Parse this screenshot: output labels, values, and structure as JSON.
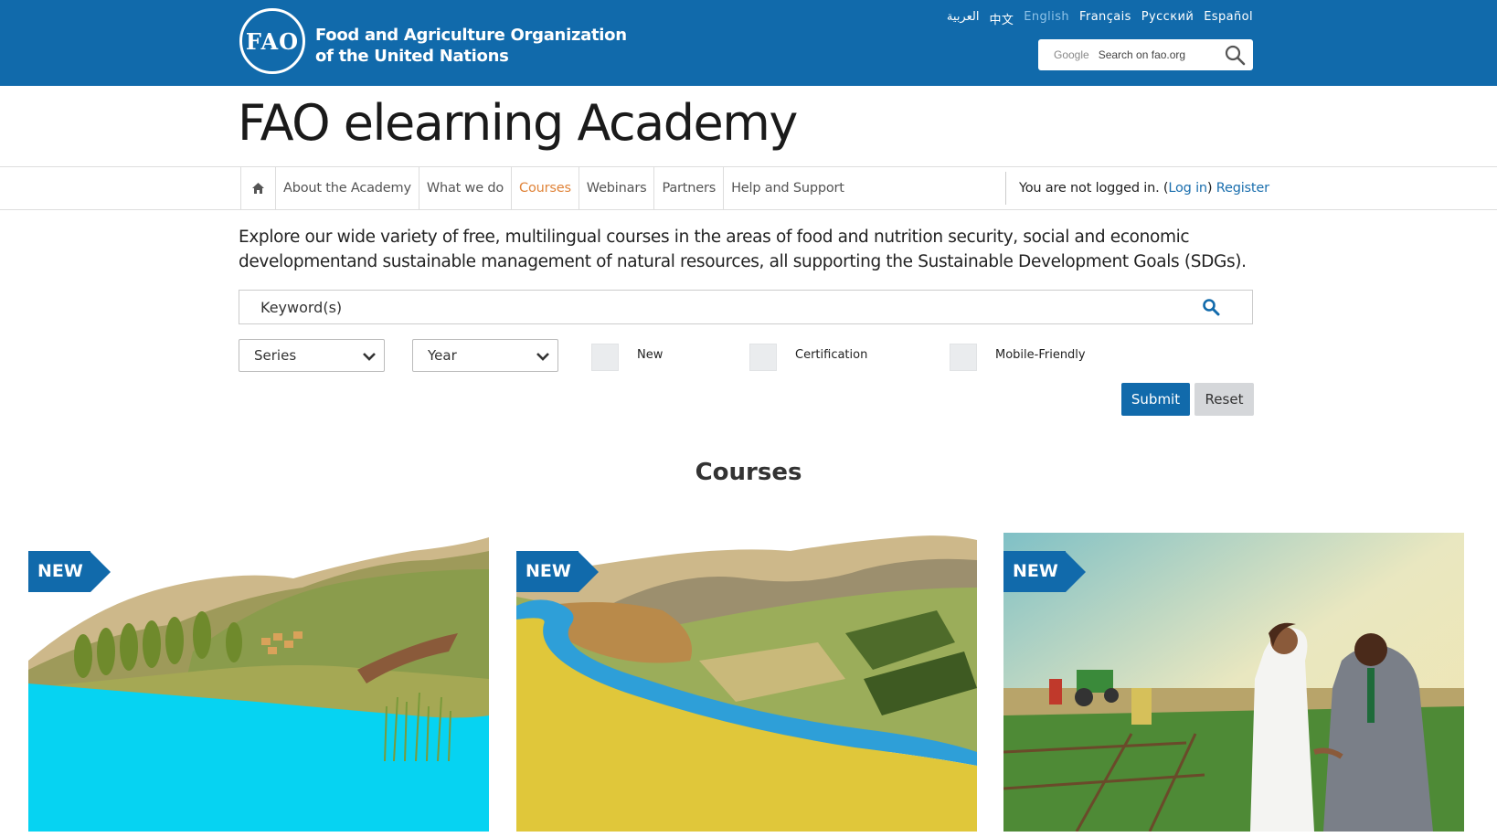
{
  "header": {
    "org_line1": "Food and Agriculture Organization",
    "org_line2": "of the United Nations",
    "logo_text": "FAO",
    "languages": [
      "العربية",
      "中文",
      "English",
      "Français",
      "Русский",
      "Español"
    ],
    "active_language": "English",
    "search_provider": "Google",
    "search_placeholder": "Search on fao.org"
  },
  "site_title": "FAO elearning Academy",
  "nav": {
    "items": [
      {
        "label": "About the Academy"
      },
      {
        "label": "What we do"
      },
      {
        "label": "Courses"
      },
      {
        "label": "Webinars"
      },
      {
        "label": "Partners"
      },
      {
        "label": "Help and Support"
      }
    ],
    "active": "Courses",
    "login_prefix": "You are not logged in. (",
    "login_link": "Log in",
    "login_suffix": ")",
    "register_link": "Register"
  },
  "intro": {
    "line1": "Explore our wide variety of free, multilingual courses in the areas of food and nutrition security, social and economic",
    "line2": "developmentand sustainable management of natural resources, all supporting the Sustainable Development Goals (SDGs)."
  },
  "filters": {
    "keyword_placeholder": "Keyword(s)",
    "series_label": "Series",
    "year_label": "Year",
    "checkbox_new": "New",
    "checkbox_certification": "Certification",
    "checkbox_mobile": "Mobile-Friendly",
    "submit_label": "Submit",
    "reset_label": "Reset"
  },
  "courses": {
    "section_title": "Courses",
    "cards": [
      {
        "badge": "NEW"
      },
      {
        "badge": "NEW"
      },
      {
        "badge": "NEW"
      }
    ]
  },
  "colors": {
    "brand_blue": "#116aab",
    "active_nav": "#e0843a",
    "link_blue": "#1b6fae"
  }
}
